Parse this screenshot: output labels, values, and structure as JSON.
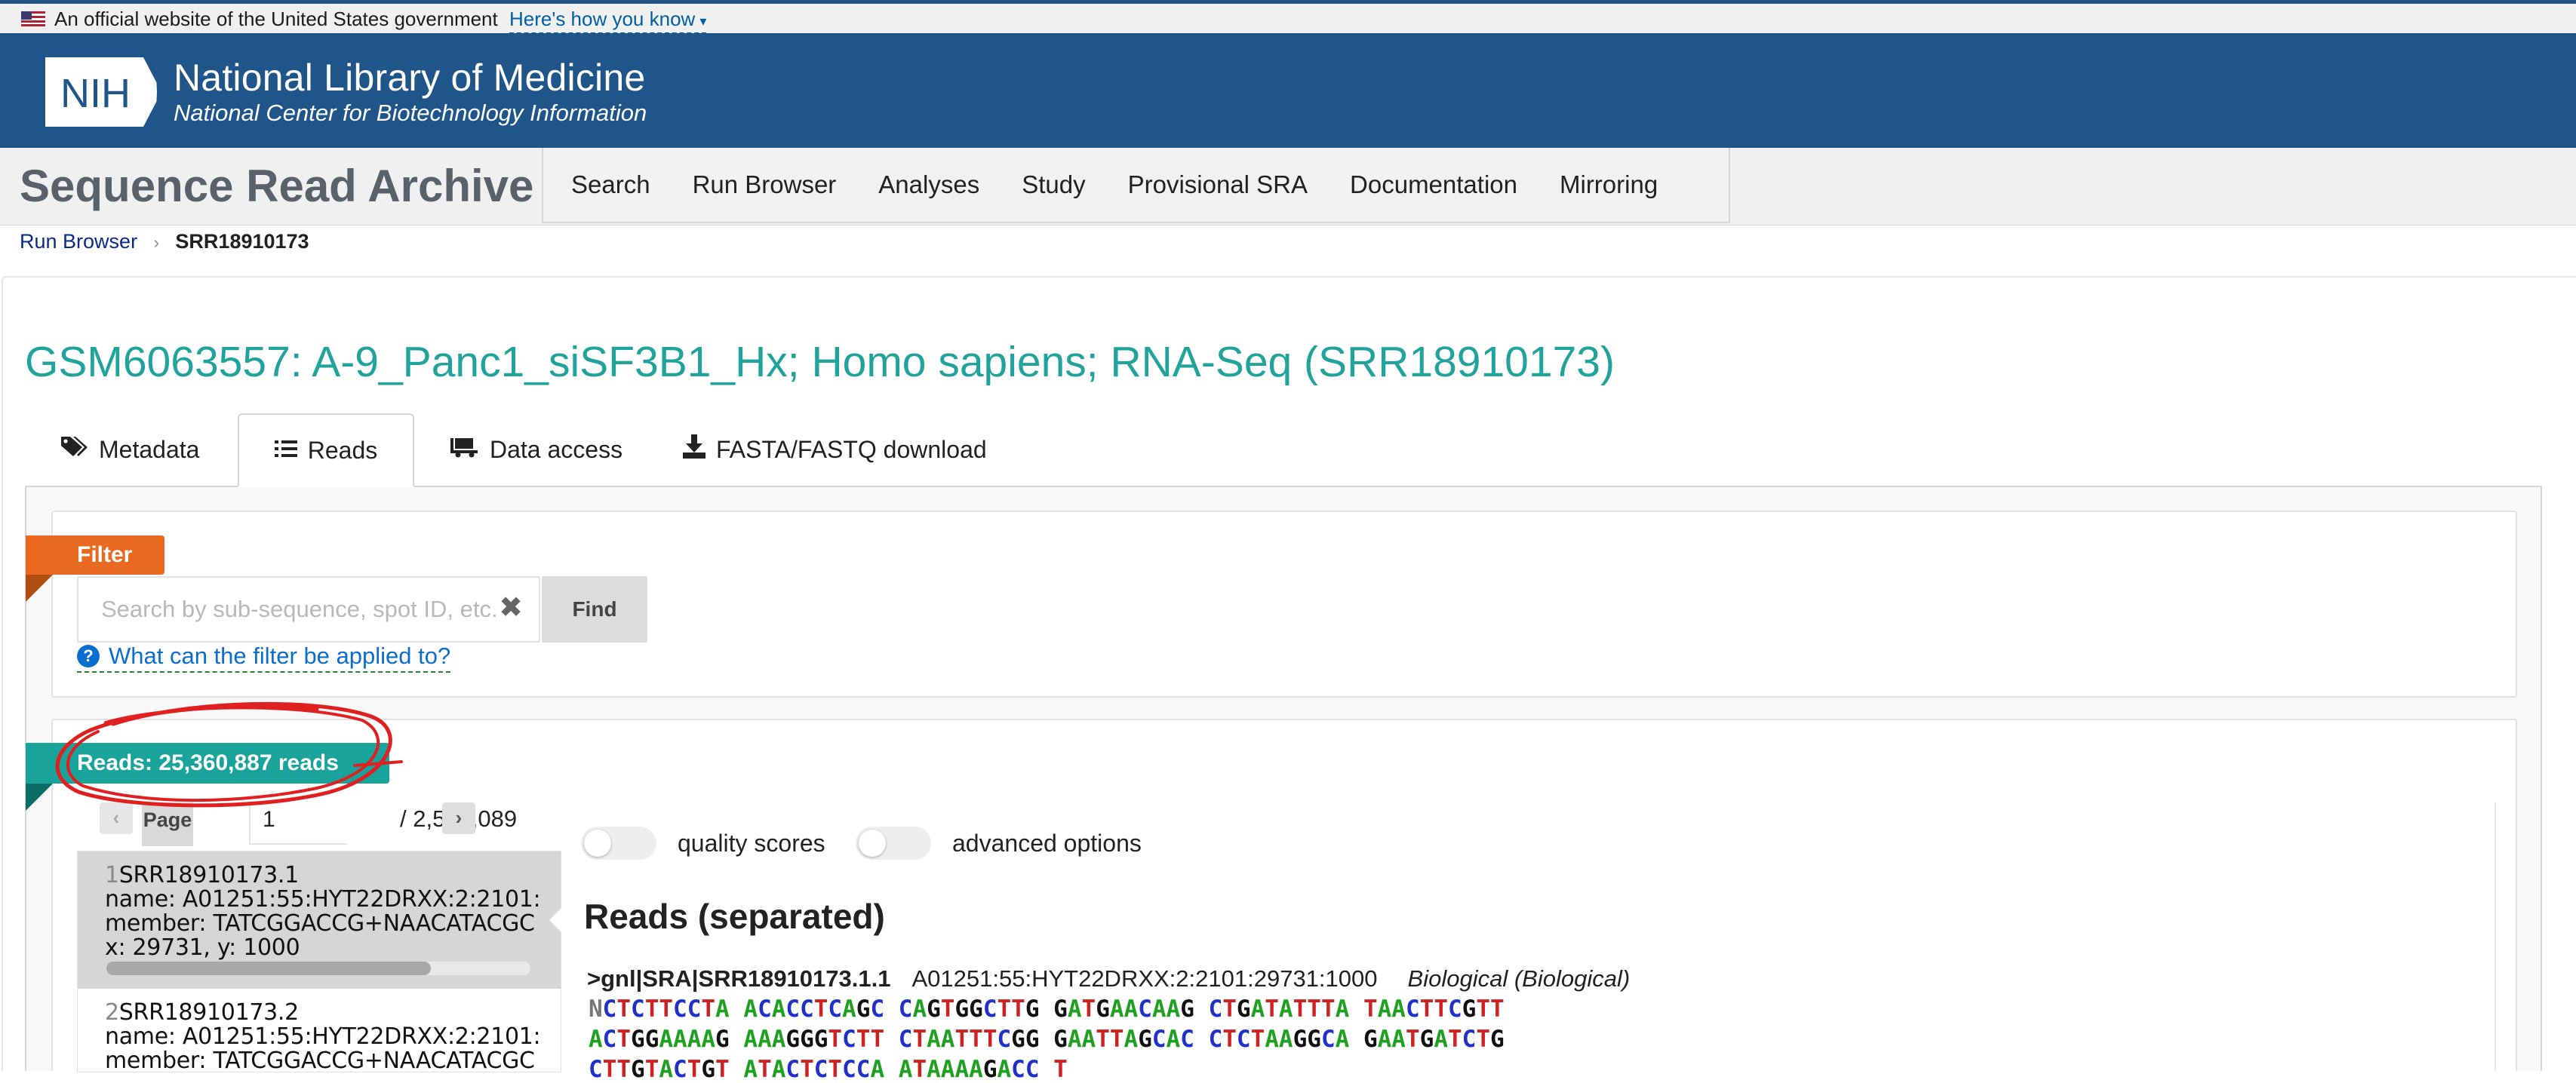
{
  "gov_banner": {
    "text": "An official website of the United States government",
    "link": "Here's how you know"
  },
  "nih": {
    "logo_text": "NIH",
    "title": "National Library of Medicine",
    "subtitle": "National Center for Biotechnology Information"
  },
  "sra": {
    "title": "Sequence Read Archive",
    "nav": [
      "Search",
      "Run Browser",
      "Analyses",
      "Study",
      "Provisional SRA",
      "Documentation",
      "Mirroring"
    ]
  },
  "breadcrumb": {
    "link": "Run Browser",
    "current": "SRR18910173"
  },
  "page_title": "GSM6063557: A-9_Panc1_siSF3B1_Hx; Homo sapiens; RNA-Seq (SRR18910173)",
  "tabs": [
    {
      "label": "Metadata",
      "icon": "tags-icon"
    },
    {
      "label": "Reads",
      "icon": "list-icon",
      "active": true
    },
    {
      "label": "Data access",
      "icon": "truck-icon"
    },
    {
      "label": "FASTA/FASTQ download",
      "icon": "download-icon"
    }
  ],
  "filter": {
    "tag": "Filter",
    "placeholder": "Search by sub-sequence, spot ID, etc.",
    "find_label": "Find",
    "help_link": "What can the filter be applied to?"
  },
  "reads": {
    "tag": "Reads: 25,360,887 reads",
    "pager": {
      "page_label": "Page",
      "page_value": "1",
      "total": "/ 2,536,089"
    },
    "list": [
      {
        "num": "1",
        "id": "SRR18910173.1",
        "name": "name: A01251:55:HYT22DRXX:2:2101:",
        "member": "member: TATCGGACCG+NAACATACGC",
        "xy": "x: 29731, y: 1000"
      },
      {
        "num": "2",
        "id": "SRR18910173.2",
        "name": "name: A01251:55:HYT22DRXX:2:2101:",
        "member": "member: TATCGGACCG+NAACATACGC"
      }
    ],
    "toggles": [
      "quality scores",
      "advanced options"
    ],
    "heading": "Reads (separated)",
    "sequence": {
      "id": ">gnl|SRA|SRR18910173.1.1",
      "desc": "A01251:55:HYT22DRXX:2:2101:29731:1000",
      "type": "Biological (Biological)",
      "lines": [
        "NCTCTTCCTA ACACCTCAGC CAGTGGCTTG GATGAACAAG CTGATATTTA TAACTTCGTT",
        "ACTGGAAAAG AAAGGGTCTT CTAATTTCGG GAATTAGCAC CTCTAAGGCA GAATGATCTG",
        "CTTGTACTGT ATACTCTCCA ATAAAAGACC T"
      ]
    }
  },
  "colors": {
    "nih_blue": "#20558a",
    "teal_title": "#20a39b",
    "filter_orange": "#e8691f",
    "reads_teal": "#1aa39a",
    "annotation_red": "#e02020"
  }
}
